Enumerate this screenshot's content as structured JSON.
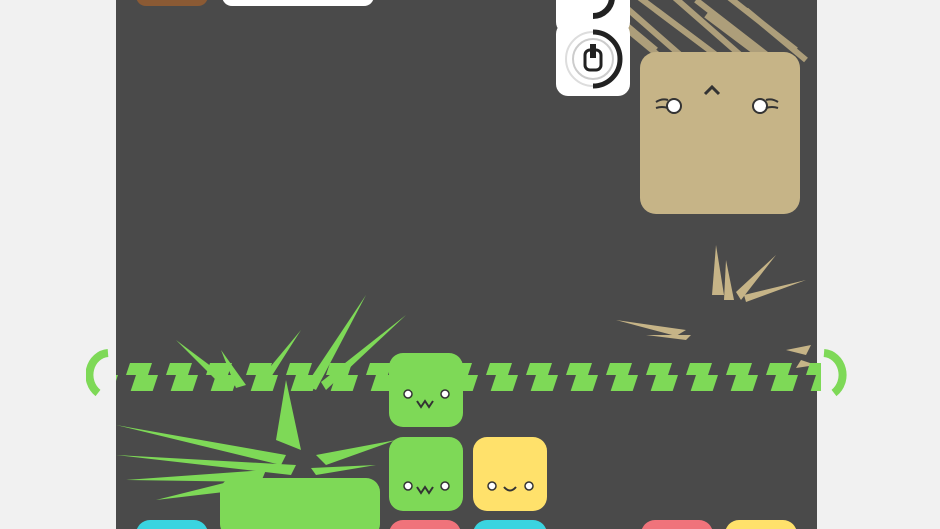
{
  "colors": {
    "board": "#4a4a4a",
    "background": "#f1f1f1",
    "green": "#7ed957",
    "yellow": "#ffe16b",
    "tan": "#c6b487",
    "brown": "#8b5a34",
    "cyan": "#3ad4e0",
    "pink": "#f0737b",
    "white": "#ffffff"
  },
  "icons": {
    "powerup_top": "bomb-timer-icon",
    "powerup_bottom": "bomb-timer-icon"
  }
}
